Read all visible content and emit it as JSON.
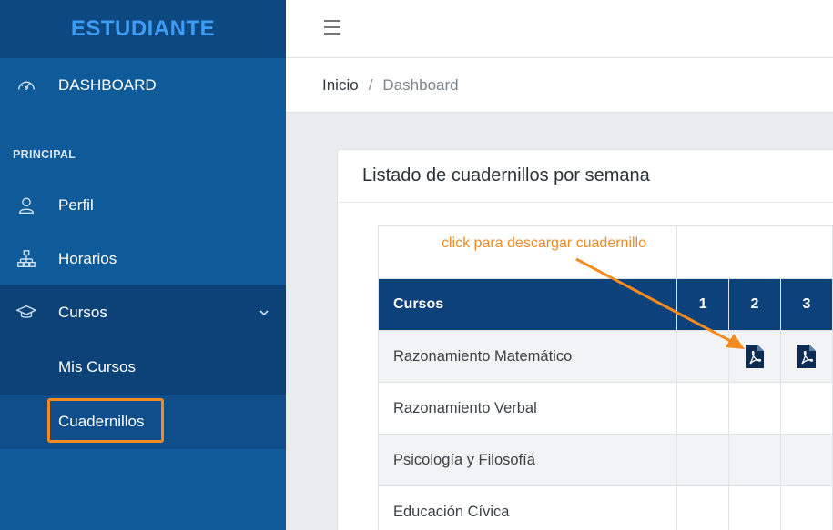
{
  "sidebar": {
    "brand": "ESTUDIANTE",
    "dashboard_label": "DASHBOARD",
    "section_title": "PRINCIPAL",
    "items": [
      {
        "label": "Perfil",
        "icon": "user-icon"
      },
      {
        "label": "Horarios",
        "icon": "sitemap-icon"
      },
      {
        "label": "Cursos",
        "icon": "graduation-cap-icon"
      }
    ],
    "sub_items": [
      {
        "label": "Mis Cursos"
      },
      {
        "label": "Cuadernillos"
      }
    ]
  },
  "topbar": {
    "menu_icon": "hamburger-icon"
  },
  "breadcrumb": {
    "home": "Inicio",
    "separator": "/",
    "current": "Dashboard"
  },
  "card": {
    "title": "Listado de cuadernillos por semana"
  },
  "annotation": {
    "text": "click para descargar cuadernillo",
    "color": "#f08a24"
  },
  "table": {
    "headers": [
      "Cursos",
      "1",
      "2",
      "3"
    ],
    "rows": [
      {
        "name": "Razonamiento Matemático",
        "pdf_weeks": [
          2,
          3
        ]
      },
      {
        "name": "Razonamiento Verbal",
        "pdf_weeks": []
      },
      {
        "name": "Psicología y Filosofía",
        "pdf_weeks": []
      },
      {
        "name": "Educación Cívica",
        "pdf_weeks": []
      }
    ]
  },
  "colors": {
    "sidebar_bg": "#0f5a99",
    "header_bg": "#0d4179",
    "brand_text": "#3d9cf5",
    "highlight": "#f58a1f"
  }
}
